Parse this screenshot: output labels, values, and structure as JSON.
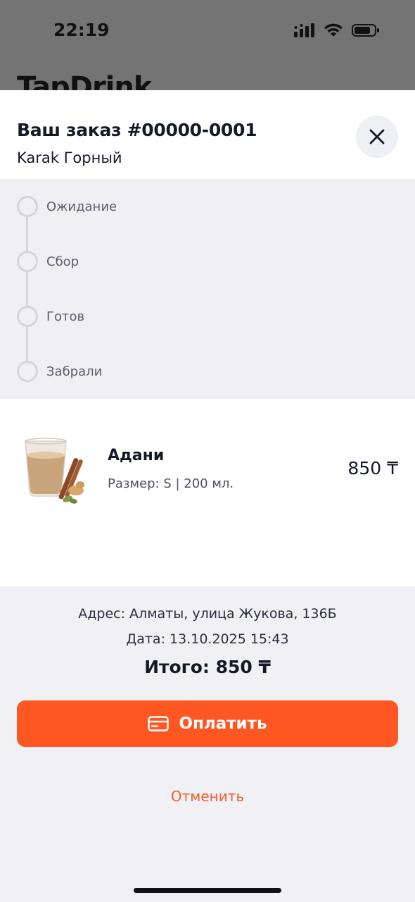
{
  "status_bar": {
    "time": "22:19"
  },
  "background": {
    "app_title": "TapDrink"
  },
  "header": {
    "order_title": "Ваш заказ #00000-0001",
    "shop_name": "Karak Горный"
  },
  "steps": [
    {
      "label": "Ожидание"
    },
    {
      "label": "Сбор"
    },
    {
      "label": "Готов"
    },
    {
      "label": "Забрали"
    }
  ],
  "item": {
    "name": "Адани",
    "size": "Размер: S | 200 мл.",
    "price": "850 ₸"
  },
  "summary": {
    "address": "Адрес: Алматы, улица Жукова, 136Б",
    "date": "Дата: 13.10.2025 15:43",
    "total": "Итого: 850 ₸"
  },
  "actions": {
    "pay_label": "Оплатить",
    "cancel_label": "Отменить"
  },
  "colors": {
    "accent": "#ff5722",
    "cancel_text": "#f1612d",
    "status_bar_dim": "#747474"
  },
  "icons": {
    "close": "close-icon",
    "pay": "credit-card-icon"
  }
}
